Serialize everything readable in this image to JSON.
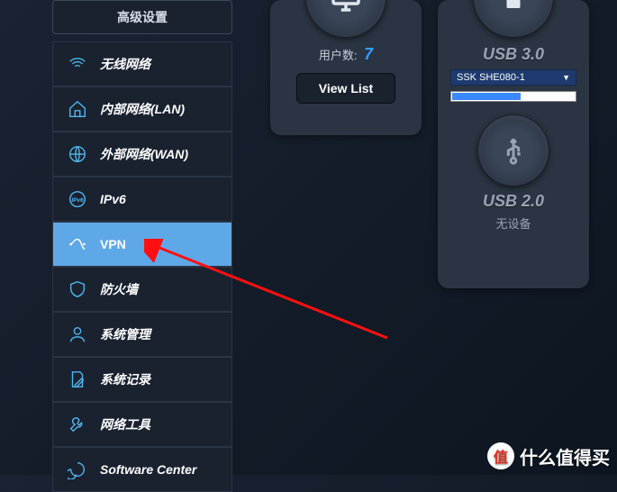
{
  "sidebar": {
    "header": "高级设置",
    "items": [
      {
        "id": "wireless",
        "label": "无线网络"
      },
      {
        "id": "lan",
        "label": "内部网络(LAN)"
      },
      {
        "id": "wan",
        "label": "外部网络(WAN)"
      },
      {
        "id": "ipv6",
        "label": "IPv6"
      },
      {
        "id": "vpn",
        "label": "VPN",
        "active": true
      },
      {
        "id": "firewall",
        "label": "防火墙"
      },
      {
        "id": "admin",
        "label": "系统管理"
      },
      {
        "id": "log",
        "label": "系统记录"
      },
      {
        "id": "tools",
        "label": "网络工具"
      },
      {
        "id": "software",
        "label": "Software Center"
      }
    ]
  },
  "clients": {
    "label": "用户数:",
    "count": "7",
    "button": "View List"
  },
  "usb": {
    "port1_title": "USB 3.0",
    "port1_device": "SSK SHE080-1",
    "port1_usage_percent": 55,
    "port2_title": "USB 2.0",
    "port2_status": "无设备"
  },
  "watermark": {
    "badge": "值",
    "text": "什么值得买"
  }
}
